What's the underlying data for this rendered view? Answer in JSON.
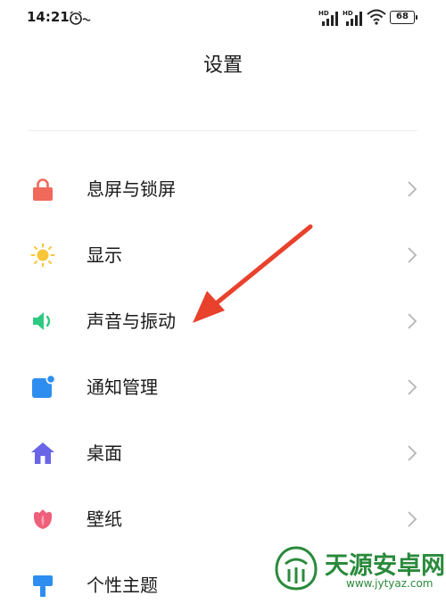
{
  "status_bar": {
    "time": "14:21",
    "signal_1_label": "HD",
    "signal_2_label": "HD",
    "battery": "68"
  },
  "header": {
    "title": "设置"
  },
  "settings_items": [
    {
      "label": "息屏与锁屏",
      "icon": "lock-icon",
      "color": "#f0695a"
    },
    {
      "label": "显示",
      "icon": "sun-icon",
      "color": "#f7c63a"
    },
    {
      "label": "声音与振动",
      "icon": "speaker-icon",
      "color": "#2ec983"
    },
    {
      "label": "通知管理",
      "icon": "notification-icon",
      "color": "#2d8ef0"
    },
    {
      "label": "桌面",
      "icon": "home-icon",
      "color": "#6a64e6"
    },
    {
      "label": "壁纸",
      "icon": "tulip-icon",
      "color": "#ef5f7a"
    },
    {
      "label": "个性主题",
      "icon": "brush-icon",
      "color": "#2d8ef0"
    }
  ],
  "annotation": {
    "color": "#e8412c"
  },
  "watermark": {
    "title": "天源安卓网",
    "url": "www.jytyaz.com"
  }
}
